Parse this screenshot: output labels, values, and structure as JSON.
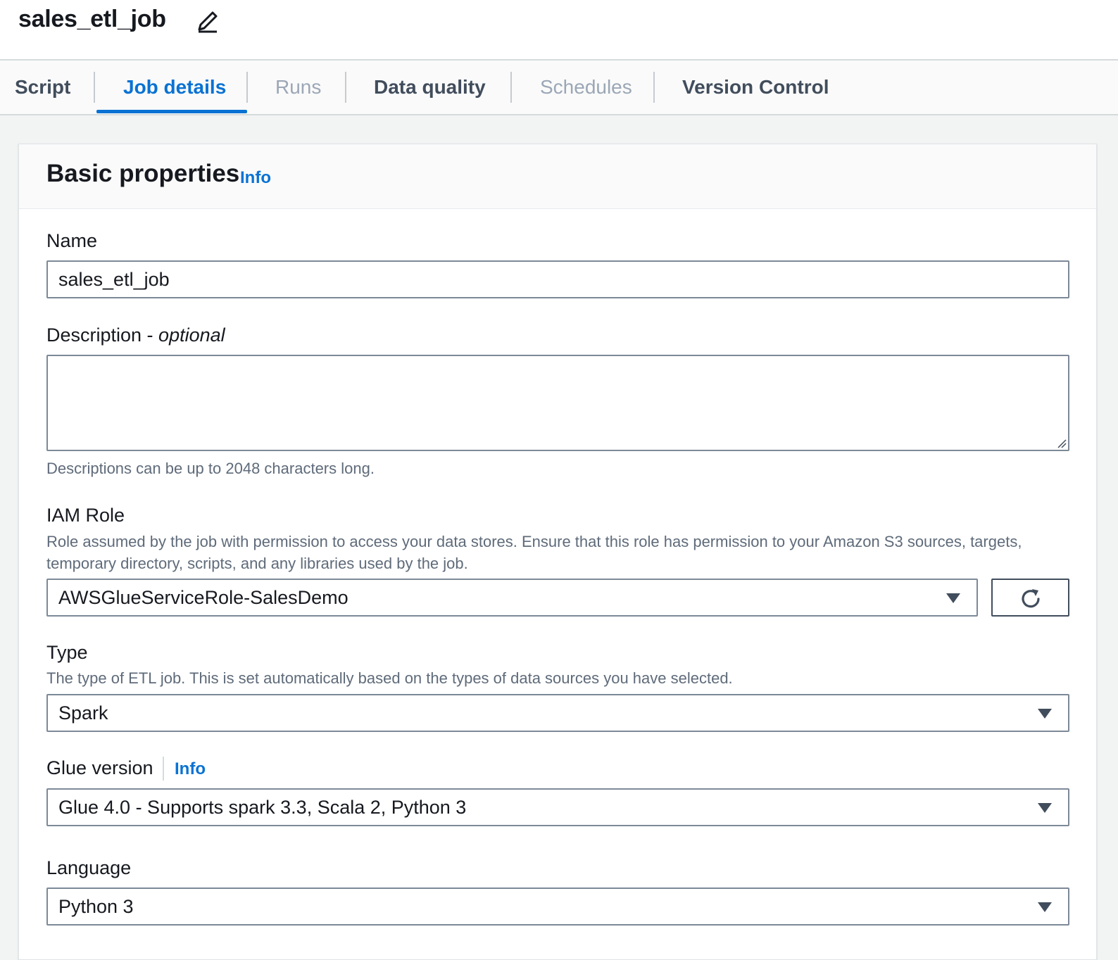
{
  "header": {
    "job_name": "sales_etl_job"
  },
  "tabs": [
    {
      "label": "Script"
    },
    {
      "label": "Job details"
    },
    {
      "label": "Runs"
    },
    {
      "label": "Data quality"
    },
    {
      "label": "Schedules"
    },
    {
      "label": "Version Control"
    }
  ],
  "panel": {
    "title": "Basic properties",
    "info_label": "Info"
  },
  "name": {
    "label": "Name",
    "value": "sales_etl_job"
  },
  "description": {
    "label": "Description - ",
    "label_optional": "optional",
    "value": "",
    "hint": "Descriptions can be up to 2048 characters long."
  },
  "iam_role": {
    "label": "IAM Role",
    "hint": "Role assumed by the job with permission to access your data stores. Ensure that this role has permission to your Amazon S3 sources, targets, temporary directory, scripts, and any libraries used by the job.",
    "value": "AWSGlueServiceRole-SalesDemo"
  },
  "type": {
    "label": "Type",
    "hint": "The type of ETL job. This is set automatically based on the types of data sources you have selected.",
    "value": "Spark"
  },
  "glue_version": {
    "label": "Glue version",
    "info_label": "Info",
    "value": "Glue 4.0 - Supports spark 3.3, Scala 2, Python 3"
  },
  "language": {
    "label": "Language",
    "value": "Python 3"
  },
  "colors": {
    "accent": "#0972d3",
    "border": "#7d8998",
    "text": "#16191f",
    "muted": "#5f6b7a"
  }
}
